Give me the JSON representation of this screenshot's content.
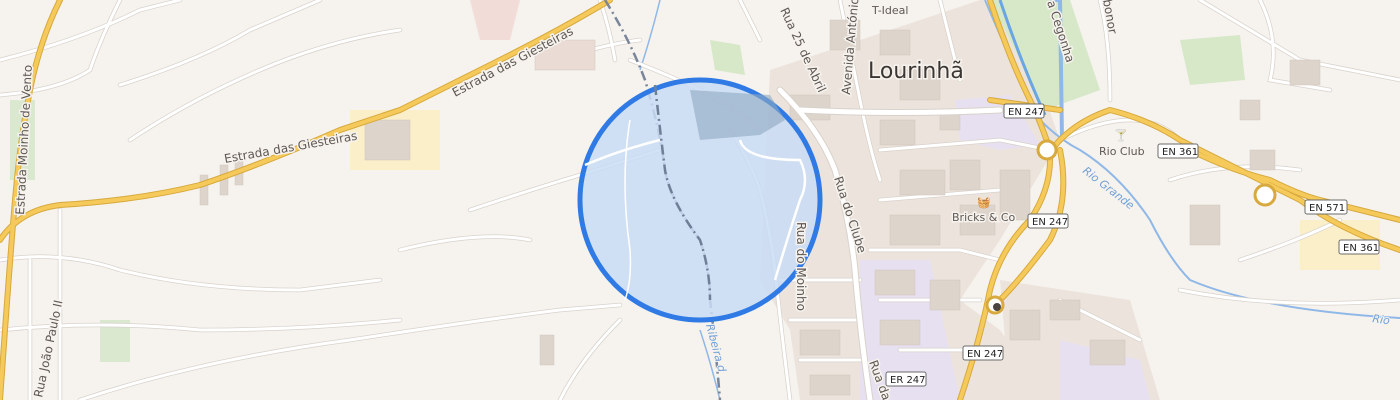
{
  "map": {
    "town": "Lourinhã",
    "streets": {
      "estrada_gisteiras_1": "Estrada das Giesteiras",
      "estrada_gisteiras_2": "Estrada das Giesteiras",
      "estrada_moinho_vento": "Estrada Moinho de Vento",
      "rua_joao_paulo": "Rua João Paulo II",
      "rua_25_abril": "Rua 25 de Abril",
      "avenida_antonio": "Avenida António",
      "rua_do_clube": "Rua do Clube",
      "rua_do_moinho": "Rua do Moinho",
      "rua_da": "Rua da",
      "rua_cegonha": "a Cegonha",
      "t_ideal": "T-Ideal",
      "bonor": "bonor"
    },
    "rivers": {
      "rio_grande": "Rio Grande",
      "rio": "Rio",
      "ribeira": "Ribeira d"
    },
    "pois": {
      "rio_club": "Rio Club",
      "bricks_co": "Bricks & Co"
    },
    "road_shields": {
      "en247_a": "EN 247",
      "en247_b": "EN 247",
      "en247_c": "EN 247",
      "en361_a": "EN 361",
      "en361_b": "EN 361",
      "en571": "EN 571",
      "er247": "ER 247"
    },
    "colors": {
      "background": "#f6f3ee",
      "major_road": "#f5c95a",
      "minor_road": "#ffffff",
      "water": "#8fb8e8",
      "park": "#d6e8c8",
      "urban": "#ebe2da",
      "highlight_fill": "#c9dcf5",
      "highlight_stroke": "#2f7ae5",
      "railway": "#7a8599"
    }
  }
}
